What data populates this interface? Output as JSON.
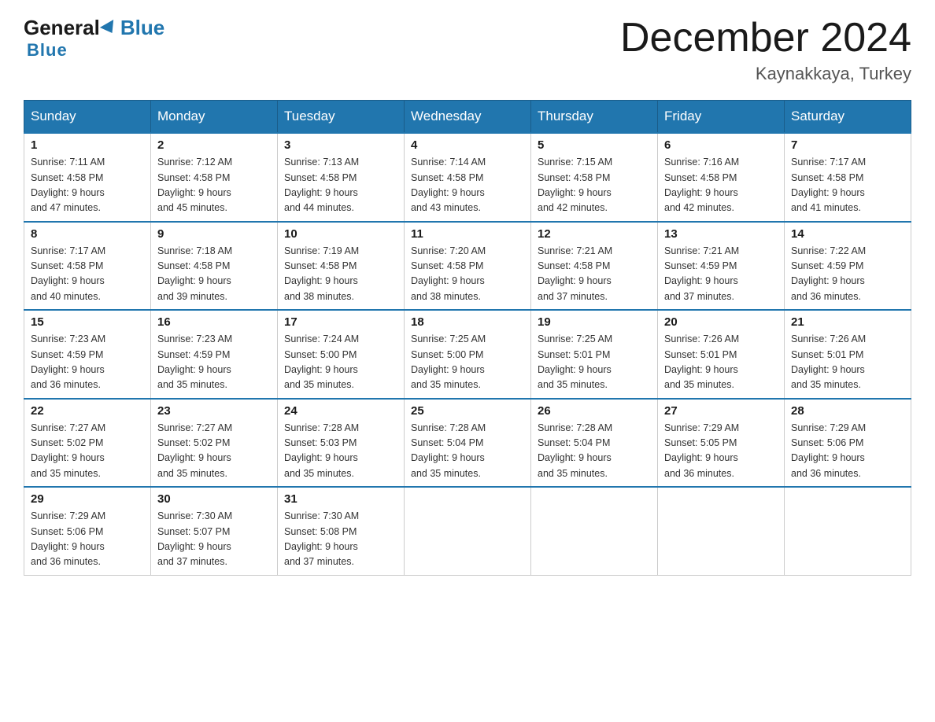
{
  "header": {
    "logo_general": "General",
    "logo_blue": "Blue",
    "month_title": "December 2024",
    "location": "Kaynakkaya, Turkey"
  },
  "weekdays": [
    "Sunday",
    "Monday",
    "Tuesday",
    "Wednesday",
    "Thursday",
    "Friday",
    "Saturday"
  ],
  "weeks": [
    [
      {
        "day": "1",
        "sunrise": "7:11 AM",
        "sunset": "4:58 PM",
        "daylight": "9 hours and 47 minutes."
      },
      {
        "day": "2",
        "sunrise": "7:12 AM",
        "sunset": "4:58 PM",
        "daylight": "9 hours and 45 minutes."
      },
      {
        "day": "3",
        "sunrise": "7:13 AM",
        "sunset": "4:58 PM",
        "daylight": "9 hours and 44 minutes."
      },
      {
        "day": "4",
        "sunrise": "7:14 AM",
        "sunset": "4:58 PM",
        "daylight": "9 hours and 43 minutes."
      },
      {
        "day": "5",
        "sunrise": "7:15 AM",
        "sunset": "4:58 PM",
        "daylight": "9 hours and 42 minutes."
      },
      {
        "day": "6",
        "sunrise": "7:16 AM",
        "sunset": "4:58 PM",
        "daylight": "9 hours and 42 minutes."
      },
      {
        "day": "7",
        "sunrise": "7:17 AM",
        "sunset": "4:58 PM",
        "daylight": "9 hours and 41 minutes."
      }
    ],
    [
      {
        "day": "8",
        "sunrise": "7:17 AM",
        "sunset": "4:58 PM",
        "daylight": "9 hours and 40 minutes."
      },
      {
        "day": "9",
        "sunrise": "7:18 AM",
        "sunset": "4:58 PM",
        "daylight": "9 hours and 39 minutes."
      },
      {
        "day": "10",
        "sunrise": "7:19 AM",
        "sunset": "4:58 PM",
        "daylight": "9 hours and 38 minutes."
      },
      {
        "day": "11",
        "sunrise": "7:20 AM",
        "sunset": "4:58 PM",
        "daylight": "9 hours and 38 minutes."
      },
      {
        "day": "12",
        "sunrise": "7:21 AM",
        "sunset": "4:58 PM",
        "daylight": "9 hours and 37 minutes."
      },
      {
        "day": "13",
        "sunrise": "7:21 AM",
        "sunset": "4:59 PM",
        "daylight": "9 hours and 37 minutes."
      },
      {
        "day": "14",
        "sunrise": "7:22 AM",
        "sunset": "4:59 PM",
        "daylight": "9 hours and 36 minutes."
      }
    ],
    [
      {
        "day": "15",
        "sunrise": "7:23 AM",
        "sunset": "4:59 PM",
        "daylight": "9 hours and 36 minutes."
      },
      {
        "day": "16",
        "sunrise": "7:23 AM",
        "sunset": "4:59 PM",
        "daylight": "9 hours and 35 minutes."
      },
      {
        "day": "17",
        "sunrise": "7:24 AM",
        "sunset": "5:00 PM",
        "daylight": "9 hours and 35 minutes."
      },
      {
        "day": "18",
        "sunrise": "7:25 AM",
        "sunset": "5:00 PM",
        "daylight": "9 hours and 35 minutes."
      },
      {
        "day": "19",
        "sunrise": "7:25 AM",
        "sunset": "5:01 PM",
        "daylight": "9 hours and 35 minutes."
      },
      {
        "day": "20",
        "sunrise": "7:26 AM",
        "sunset": "5:01 PM",
        "daylight": "9 hours and 35 minutes."
      },
      {
        "day": "21",
        "sunrise": "7:26 AM",
        "sunset": "5:01 PM",
        "daylight": "9 hours and 35 minutes."
      }
    ],
    [
      {
        "day": "22",
        "sunrise": "7:27 AM",
        "sunset": "5:02 PM",
        "daylight": "9 hours and 35 minutes."
      },
      {
        "day": "23",
        "sunrise": "7:27 AM",
        "sunset": "5:02 PM",
        "daylight": "9 hours and 35 minutes."
      },
      {
        "day": "24",
        "sunrise": "7:28 AM",
        "sunset": "5:03 PM",
        "daylight": "9 hours and 35 minutes."
      },
      {
        "day": "25",
        "sunrise": "7:28 AM",
        "sunset": "5:04 PM",
        "daylight": "9 hours and 35 minutes."
      },
      {
        "day": "26",
        "sunrise": "7:28 AM",
        "sunset": "5:04 PM",
        "daylight": "9 hours and 35 minutes."
      },
      {
        "day": "27",
        "sunrise": "7:29 AM",
        "sunset": "5:05 PM",
        "daylight": "9 hours and 36 minutes."
      },
      {
        "day": "28",
        "sunrise": "7:29 AM",
        "sunset": "5:06 PM",
        "daylight": "9 hours and 36 minutes."
      }
    ],
    [
      {
        "day": "29",
        "sunrise": "7:29 AM",
        "sunset": "5:06 PM",
        "daylight": "9 hours and 36 minutes."
      },
      {
        "day": "30",
        "sunrise": "7:30 AM",
        "sunset": "5:07 PM",
        "daylight": "9 hours and 37 minutes."
      },
      {
        "day": "31",
        "sunrise": "7:30 AM",
        "sunset": "5:08 PM",
        "daylight": "9 hours and 37 minutes."
      },
      null,
      null,
      null,
      null
    ]
  ],
  "labels": {
    "sunrise": "Sunrise:",
    "sunset": "Sunset:",
    "daylight": "Daylight:"
  }
}
